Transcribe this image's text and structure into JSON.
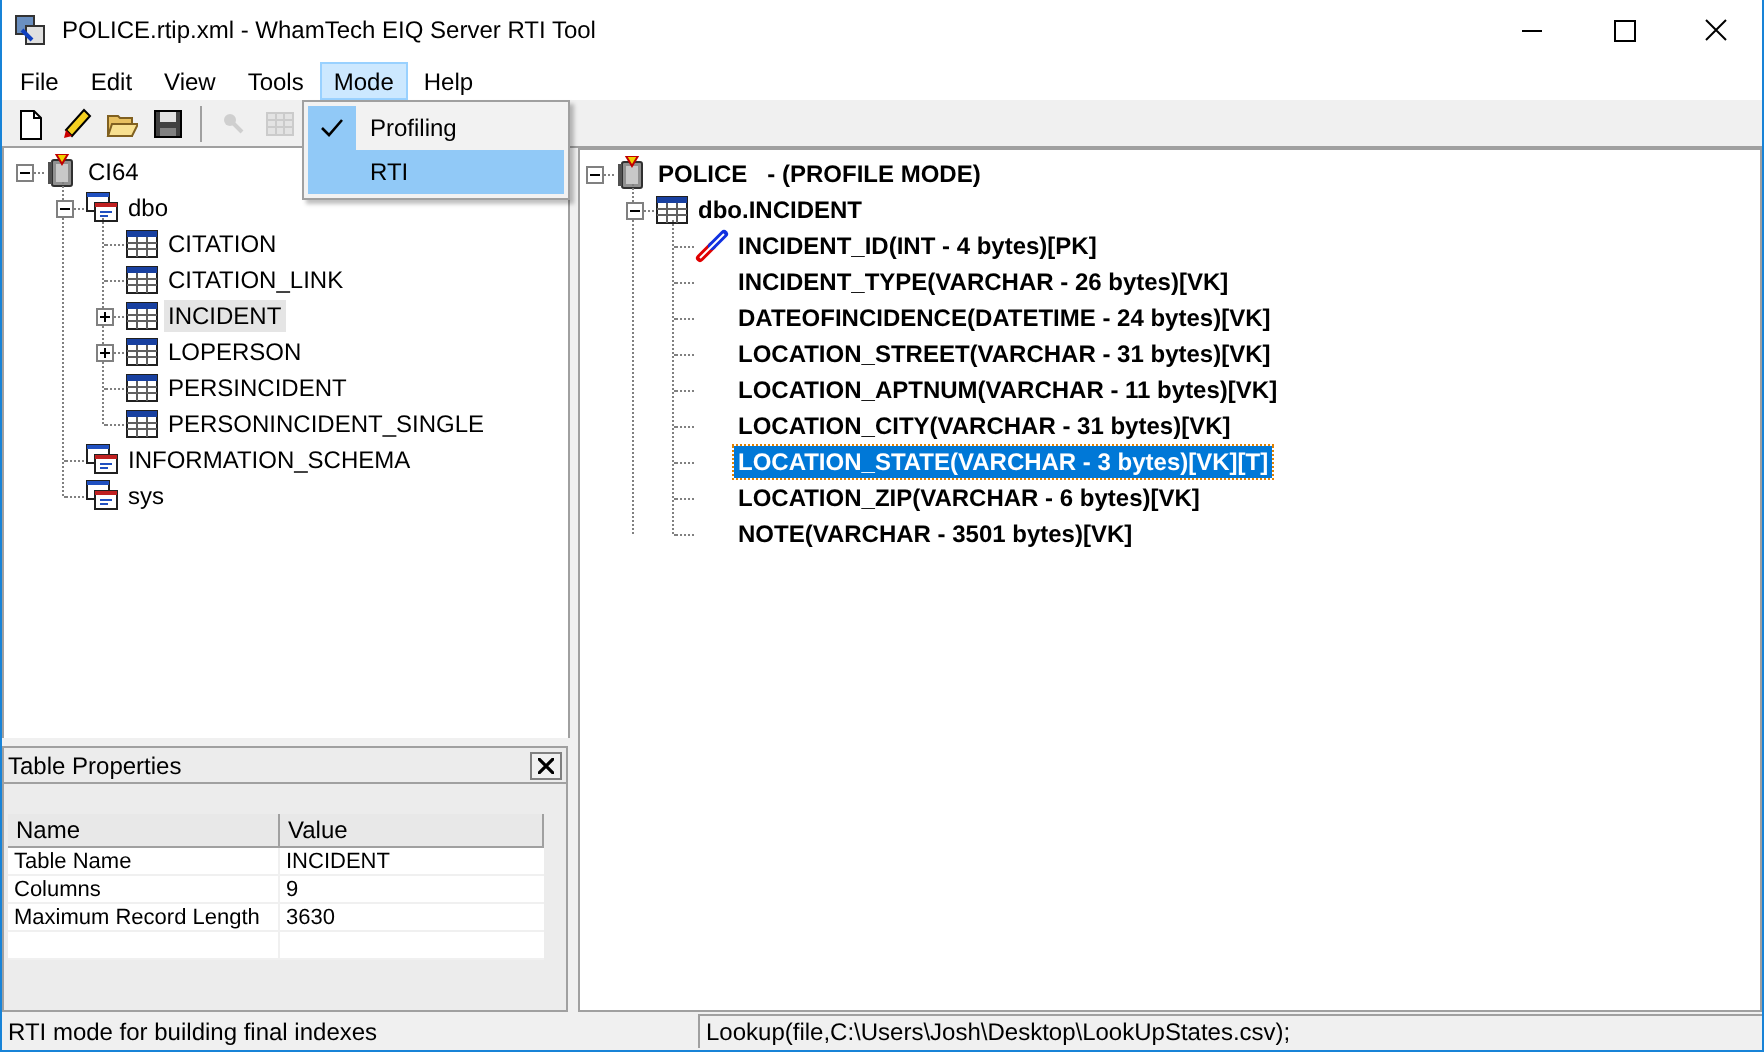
{
  "window": {
    "title": "POLICE.rtip.xml - WhamTech EIQ Server RTI Tool"
  },
  "menu": [
    {
      "label": "File",
      "selected": false
    },
    {
      "label": "Edit",
      "selected": false
    },
    {
      "label": "View",
      "selected": false
    },
    {
      "label": "Tools",
      "selected": false
    },
    {
      "label": "Mode",
      "selected": true
    },
    {
      "label": "Help",
      "selected": false
    }
  ],
  "mode_menu": {
    "items": [
      {
        "label": "Profiling",
        "checked": true,
        "selected": false
      },
      {
        "label": "RTI",
        "checked": false,
        "selected": true
      }
    ]
  },
  "toolbar": [
    {
      "kind": "new",
      "disabled": false
    },
    {
      "kind": "edit",
      "disabled": false
    },
    {
      "kind": "open",
      "disabled": false
    },
    {
      "kind": "save",
      "disabled": false
    },
    {
      "kind": "separator"
    },
    {
      "kind": "tool",
      "disabled": true
    },
    {
      "kind": "grid",
      "disabled": true
    }
  ],
  "left_tree": [
    {
      "label": "CI64",
      "kind": "database",
      "expanded": true,
      "selected": false,
      "children": [
        {
          "label": "dbo",
          "kind": "schema",
          "expanded": true,
          "selected": false,
          "children": [
            {
              "label": "CITATION",
              "kind": "table",
              "selected": false
            },
            {
              "label": "CITATION_LINK",
              "kind": "table",
              "selected": false
            },
            {
              "label": "INCIDENT",
              "kind": "table",
              "expanded": false,
              "selected": true
            },
            {
              "label": "LOPERSON",
              "kind": "table",
              "expanded": false,
              "selected": false
            },
            {
              "label": "PERSINCIDENT",
              "kind": "table",
              "selected": false
            },
            {
              "label": "PERSONINCIDENT_SINGLE",
              "kind": "table",
              "selected": false
            }
          ]
        },
        {
          "label": "INFORMATION_SCHEMA",
          "kind": "schema",
          "selected": false
        },
        {
          "label": "sys",
          "kind": "schema",
          "selected": false
        }
      ]
    }
  ],
  "right_tree": [
    {
      "label": "POLICE   - (PROFILE MODE)",
      "kind": "database",
      "expanded": true,
      "selected": false,
      "children": [
        {
          "label": "dbo.INCIDENT",
          "kind": "table",
          "expanded": true,
          "selected": false,
          "children": [
            {
              "label": "INCIDENT_ID(INT - 4 bytes)[PK]",
              "kind": "key",
              "selected": false
            },
            {
              "label": "INCIDENT_TYPE(VARCHAR - 26 bytes)[VK]",
              "kind": "column",
              "selected": false
            },
            {
              "label": "DATEOFINCIDENCE(DATETIME - 24 bytes)[VK]",
              "kind": "column",
              "selected": false
            },
            {
              "label": "LOCATION_STREET(VARCHAR - 31 bytes)[VK]",
              "kind": "column",
              "selected": false
            },
            {
              "label": "LOCATION_APTNUM(VARCHAR - 11 bytes)[VK]",
              "kind": "column",
              "selected": false
            },
            {
              "label": "LOCATION_CITY(VARCHAR - 31 bytes)[VK]",
              "kind": "column",
              "selected": false
            },
            {
              "label": "LOCATION_STATE(VARCHAR - 3 bytes)[VK][T]",
              "kind": "column",
              "selected": true
            },
            {
              "label": "LOCATION_ZIP(VARCHAR - 6 bytes)[VK]",
              "kind": "column",
              "selected": false
            },
            {
              "label": "NOTE(VARCHAR - 3501 bytes)[VK]",
              "kind": "column",
              "selected": false
            }
          ]
        }
      ]
    }
  ],
  "properties": {
    "title": "Table Properties",
    "columns": [
      "Name",
      "Value"
    ],
    "rows": [
      [
        "Table Name",
        "INCIDENT"
      ],
      [
        "Columns",
        "9"
      ],
      [
        "Maximum Record Length",
        "3630"
      ]
    ]
  },
  "status_bar": [
    "RTI mode for building final indexes",
    "Lookup(file,C:\\Users\\Josh\\Desktop\\LookUpStates.csv);"
  ]
}
